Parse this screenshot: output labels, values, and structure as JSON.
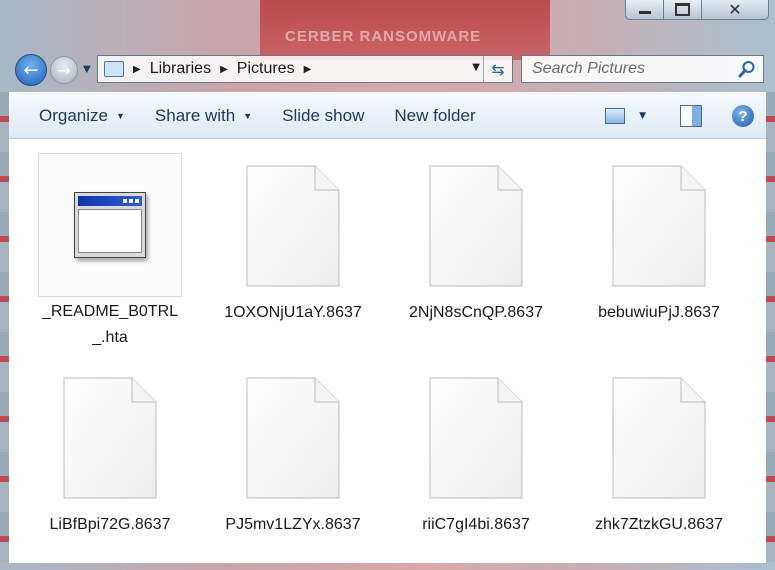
{
  "window": {
    "background_text": "CERBER RANSOMWARE",
    "caption": {
      "minimize": "minimize",
      "maximize": "maximize",
      "close": "✕"
    }
  },
  "address_bar": {
    "crumbs": [
      "Libraries",
      "Pictures"
    ]
  },
  "search": {
    "placeholder": "Search Pictures"
  },
  "toolbar": {
    "organize": "Organize",
    "share_with": "Share with",
    "slide_show": "Slide show",
    "new_folder": "New folder"
  },
  "files": [
    {
      "name": "_README_B0TRL_.hta",
      "type": "hta",
      "selected": true
    },
    {
      "name": "1OXONjU1aY.8637",
      "type": "blank"
    },
    {
      "name": "2NjN8sCnQP.8637",
      "type": "blank"
    },
    {
      "name": "bebuwiuPjJ.8637",
      "type": "blank"
    },
    {
      "name": "LiBfBpi72G.8637",
      "type": "blank"
    },
    {
      "name": "PJ5mv1LZYx.8637",
      "type": "blank"
    },
    {
      "name": "riiC7gI4bi.8637",
      "type": "blank"
    },
    {
      "name": "zhk7ZtzkGU.8637",
      "type": "blank"
    }
  ],
  "colors": {
    "command_text": "#1e395b",
    "accent": "#2a64ad",
    "banner_red": "#b43a3f"
  },
  "icons": [
    "back-arrow-icon",
    "forward-arrow-icon",
    "library-icon",
    "refresh-icon",
    "search-icon",
    "view-icon",
    "preview-pane-icon",
    "help-icon",
    "hta-file-icon",
    "blank-file-icon"
  ]
}
